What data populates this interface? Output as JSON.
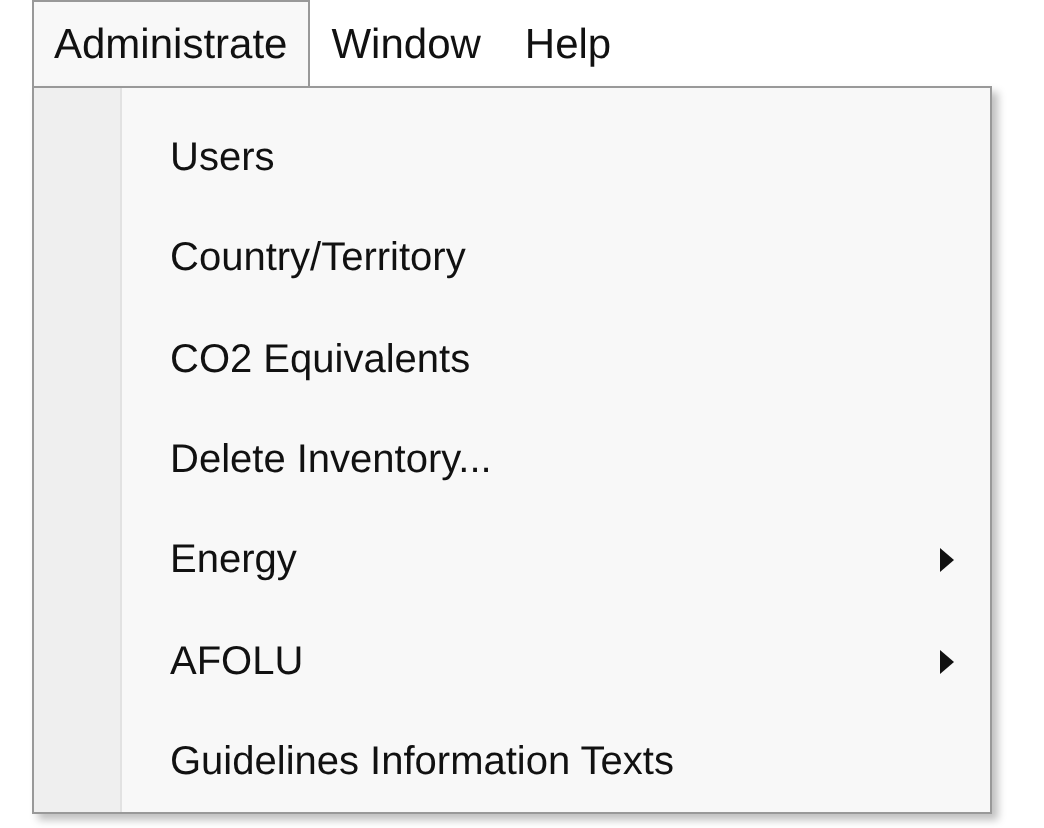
{
  "menu_bar": [
    {
      "label": "Administrate",
      "selected": true
    },
    {
      "label": "Window",
      "selected": false
    },
    {
      "label": "Help",
      "selected": false
    }
  ],
  "menu": {
    "items": [
      {
        "label": "Users",
        "has_submenu": false
      },
      {
        "label": "Country/Territory",
        "has_submenu": false
      },
      {
        "label": "CO2 Equivalents",
        "has_submenu": false
      },
      {
        "label": "Delete Inventory...",
        "has_submenu": false
      },
      {
        "label": "Energy",
        "has_submenu": true
      },
      {
        "label": "AFOLU",
        "has_submenu": true
      },
      {
        "label": "Guidelines Information Texts",
        "has_submenu": false
      }
    ]
  }
}
